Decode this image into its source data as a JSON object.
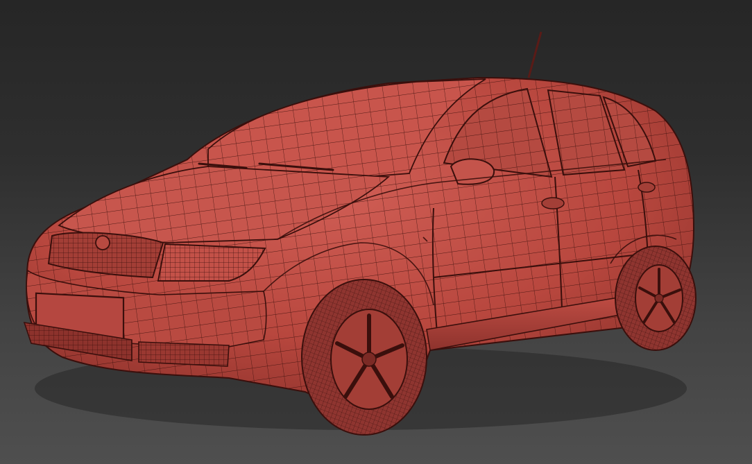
{
  "viewport": {
    "background_top": "#262626",
    "background_bottom": "#4f4f4f"
  },
  "model": {
    "subject": "hatchback car",
    "render_mode": "wireframe-on-shaded",
    "body_color": "#b8473e",
    "shadow_color": "#7d2a25",
    "highlight_color": "#d36158",
    "wire_color": "#3a0f0c",
    "tire_color": "#8f3530"
  }
}
